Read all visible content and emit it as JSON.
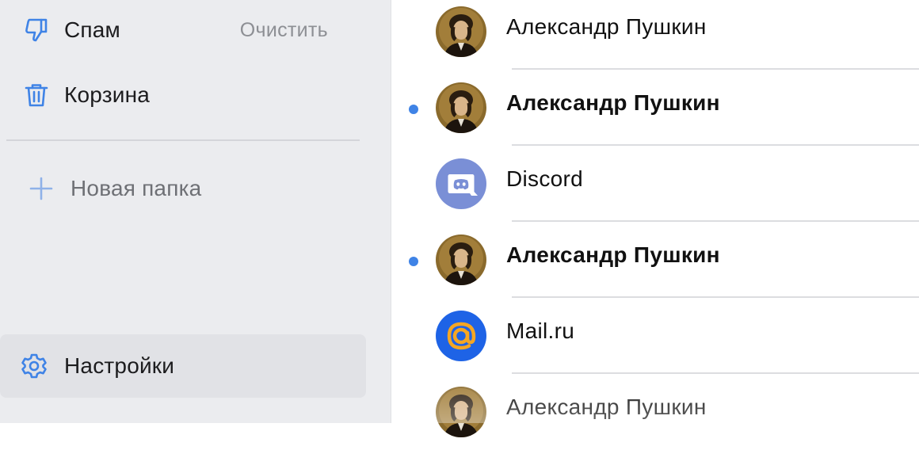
{
  "sidebar": {
    "spam": {
      "label": "Спам",
      "action": "Очистить",
      "icon": "thumbs-down-icon"
    },
    "trash": {
      "label": "Корзина",
      "icon": "trash-icon"
    },
    "new_folder": {
      "label": "Новая папка",
      "icon": "plus-icon"
    },
    "settings": {
      "label": "Настройки",
      "icon": "gear-icon"
    }
  },
  "messages": [
    {
      "sender": "Александр Пушкин",
      "unread": false,
      "avatar": "pushkin-portrait"
    },
    {
      "sender": "Александр Пушкин",
      "unread": true,
      "avatar": "pushkin-portrait"
    },
    {
      "sender": "Discord",
      "unread": false,
      "avatar": "discord-logo"
    },
    {
      "sender": "Александр Пушкин",
      "unread": true,
      "avatar": "pushkin-portrait"
    },
    {
      "sender": "Mail.ru",
      "unread": false,
      "avatar": "mailru-logo"
    },
    {
      "sender": "Александр Пушкин",
      "unread": false,
      "avatar": "pushkin-portrait"
    }
  ],
  "colors": {
    "accent": "#3f83e6",
    "sidebar_bg": "#ebecef",
    "discord": "#7a8fd6",
    "mailru": "#1e63e6",
    "mailru_at": "#f5a623"
  }
}
